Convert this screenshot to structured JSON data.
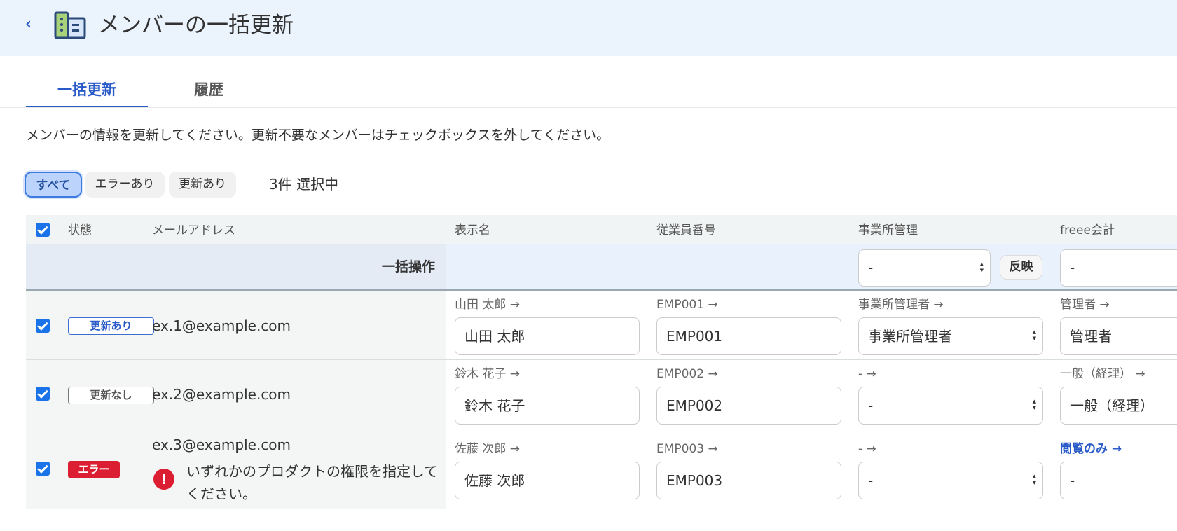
{
  "header": {
    "back_label": "‹",
    "title": "メンバーの一括更新",
    "logo_icon": "building-icon"
  },
  "tabs": [
    {
      "label": "一括更新",
      "active": true
    },
    {
      "label": "履歴",
      "active": false
    }
  ],
  "description": "メンバーの情報を更新してください。更新不要なメンバーはチェックボックスを外してください。",
  "filters": {
    "all": "すべて",
    "error": "エラーあり",
    "updated": "更新あり",
    "selected": "3件 選択中"
  },
  "columns": {
    "status": "状態",
    "email": "メールアドレス",
    "name": "表示名",
    "employee_no": "従業員番号",
    "office": "事業所管理",
    "freee": "freee会計"
  },
  "bulk": {
    "label": "一括操作",
    "office_value": "-",
    "reflect_label": "反映",
    "freee_value": "-"
  },
  "rows": [
    {
      "checked": true,
      "status": "更新あり",
      "email": "ex.1@example.com",
      "name_hint": "山田 太郎 →",
      "name": "山田 太郎",
      "emp_hint": "EMP001 →",
      "emp": "EMP001",
      "office_hint": "事業所管理者 →",
      "office": "事業所管理者",
      "freee_hint": "管理者 →",
      "freee": "管理者"
    },
    {
      "checked": true,
      "status": "更新なし",
      "email": "ex.2@example.com",
      "name_hint": "鈴木 花子 →",
      "name": "鈴木 花子",
      "emp_hint": "EMP002 →",
      "emp": "EMP002",
      "office_hint": "- →",
      "office": "-",
      "freee_hint": "一般（経理） →",
      "freee": "一般（経理）"
    },
    {
      "checked": true,
      "status": "エラー",
      "email": "ex.3@example.com",
      "error_icon": "!",
      "error_message": "いずれかのプロダクトの権限を指定してください。",
      "name_hint": "佐藤 次郎 →",
      "name": "佐藤 次郎",
      "emp_hint": "EMP003 →",
      "emp": "EMP003",
      "office_hint": "- →",
      "office": "-",
      "freee_hint": "閲覧のみ →",
      "freee": "-"
    }
  ],
  "colors": {
    "accent": "#285ac8",
    "error": "#dc1e32",
    "header_bg": "#ebf3fc"
  }
}
